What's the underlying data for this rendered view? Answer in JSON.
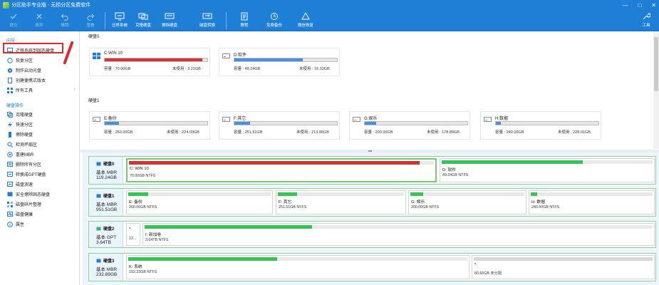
{
  "window": {
    "title": "分区助手专业版 - 无损分区免费软件",
    "minimize": "—",
    "maximize": "□",
    "close": "✕"
  },
  "toolbar": {
    "items": [
      {
        "label": "提交",
        "icon": "submit-icon"
      },
      {
        "label": "放弃",
        "icon": "discard-icon"
      },
      {
        "label": "撤销",
        "icon": "undo-icon"
      },
      {
        "label": "重做",
        "icon": "redo-icon"
      },
      {
        "label": "迁移系统",
        "icon": "migrate-os-icon"
      },
      {
        "label": "克隆硬盘",
        "icon": "clone-disk-icon"
      },
      {
        "label": "擦除硬盘",
        "icon": "wipe-disk-icon"
      },
      {
        "label": "磁盘转换",
        "icon": "disk-convert-icon"
      },
      {
        "label": "教程",
        "icon": "tutorial-icon"
      },
      {
        "label": "免费备份",
        "icon": "free-backup-icon"
      },
      {
        "label": "微信恢复",
        "icon": "wechat-recovery-icon"
      },
      {
        "label": "工具",
        "icon": "tools-icon"
      }
    ]
  },
  "sidebar": {
    "wizard_title": "向导",
    "wizard_items": [
      {
        "label": "迁移系统到固态硬盘",
        "icon": "migrate-icon"
      },
      {
        "label": "恢复分区",
        "icon": "recover-partition-icon"
      },
      {
        "label": "制作启动光盘",
        "icon": "boot-disc-icon"
      },
      {
        "label": "创建便携式版本",
        "icon": "portable-icon"
      },
      {
        "label": "所有工具",
        "icon": "all-tools-icon",
        "arrow": "›"
      }
    ],
    "disk_ops_title": "硬盘操作",
    "disk_ops_items": [
      {
        "label": "克隆硬盘",
        "icon": "clone-icon"
      },
      {
        "label": "快速分区",
        "icon": "quick-partition-icon"
      },
      {
        "label": "擦除硬盘",
        "icon": "wipe-icon"
      },
      {
        "label": "检测坏扇区",
        "icon": "bad-sector-icon"
      },
      {
        "label": "重建MBR",
        "icon": "rebuild-mbr-icon"
      },
      {
        "label": "删除所有分区",
        "icon": "delete-partitions-icon"
      },
      {
        "label": "转换成GPT硬盘",
        "icon": "convert-gpt-icon"
      },
      {
        "label": "磁盘测速",
        "icon": "speed-test-icon"
      },
      {
        "label": "安全擦除固态硬盘",
        "icon": "secure-erase-icon"
      },
      {
        "label": "磁盘碎片整理",
        "icon": "defrag-icon"
      },
      {
        "label": "磁盘健康",
        "icon": "health-icon"
      },
      {
        "label": "属性",
        "icon": "properties-icon"
      }
    ]
  },
  "volumes": {
    "disk0": {
      "label": "硬盘0",
      "items": [
        {
          "name": "C:WIN 10",
          "cap_label": "容量",
          "capacity": "70.00GB",
          "unused_label": "未使用",
          "unused": "3.21GB",
          "used_fraction": 0.954,
          "color": "#d33333"
        },
        {
          "name": "D:软件",
          "cap_label": "容量",
          "capacity": "49.24GB",
          "unused_label": "未使用",
          "unused": "16.32GB",
          "used_fraction": 0.67,
          "color": "#4a8fd8"
        }
      ]
    },
    "disk1": {
      "label": "硬盘1",
      "items": [
        {
          "name": "E:备份",
          "cap_label": "容量",
          "capacity": "260.00GB",
          "unused_label": "未使用",
          "unused": "224.03GB",
          "used_fraction": 0.14,
          "color": "#4a8fd8"
        },
        {
          "name": "F:其它",
          "cap_label": "容量",
          "capacity": "251.51GB",
          "unused_label": "未使用",
          "unused": "213.86GB",
          "used_fraction": 0.15,
          "color": "#4a8fd8"
        },
        {
          "name": "G:娱乐",
          "cap_label": "容量",
          "capacity": "200.00GB",
          "unused_label": "未使用",
          "unused": "178.89GB",
          "used_fraction": 0.11,
          "color": "#4a8fd8"
        },
        {
          "name": "H:数据",
          "cap_label": "容量",
          "capacity": "240.00GB",
          "unused_label": "未使用",
          "unused": "228.91GB",
          "used_fraction": 0.05,
          "color": "#4a8fd8"
        }
      ]
    }
  },
  "disk_map": [
    {
      "name": "硬盘0",
      "type": "基本 MBR",
      "size": "119.24GB",
      "partitions": [
        {
          "name": "C: WIN 10",
          "info": "70.00GB NTFS",
          "used_fraction": 0.954,
          "color": "#d33333"
        },
        {
          "name": "D: 软件",
          "info": "49.24GB NTFS",
          "used_fraction": 0.67,
          "color": "#33c452"
        }
      ]
    },
    {
      "name": "硬盘1",
      "type": "基本 MBR",
      "size": "951.51GB",
      "partitions": [
        {
          "name": "E: 备份",
          "info": "260.00GB NTFS",
          "used_fraction": 0.14,
          "color": "#33c452"
        },
        {
          "name": "F: 其它",
          "info": "251.51GB NTFS",
          "used_fraction": 0.15,
          "color": "#33c452"
        },
        {
          "name": "G: 娱乐",
          "info": "200.00GB NTFS",
          "used_fraction": 0.11,
          "color": "#33c452"
        },
        {
          "name": "H: 数据",
          "info": "240.00GB NTFS",
          "used_fraction": 0.05,
          "color": "#33c452"
        }
      ]
    },
    {
      "name": "硬盘2",
      "type": "基本 GPT",
      "size": "3.64TB",
      "partitions": [
        {
          "name": "*:",
          "info": "12...",
          "used_fraction": 0,
          "color": "#33c452"
        },
        {
          "name": "I: 新加卷",
          "info": "3.64TB NTFS",
          "used_fraction": 0.33,
          "color": "#33c452"
        }
      ]
    },
    {
      "name": "硬盘3",
      "type": "基本 MBR",
      "size": "232.89GB",
      "partitions": [
        {
          "name": "K: 系统",
          "info": "152.23GB NTFS",
          "used_fraction": 0.44,
          "color": "#33c452"
        },
        {
          "name": "*:",
          "info": "80.66GB 未分配",
          "used_fraction": 0,
          "color": "#cccccc"
        }
      ]
    }
  ]
}
